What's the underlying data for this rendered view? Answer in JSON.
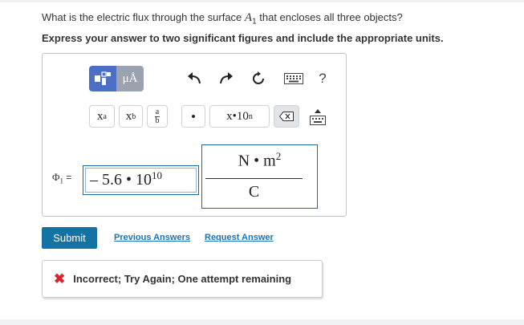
{
  "question": {
    "prefix": "What is the electric flux through the surface ",
    "symbol": "A",
    "subscript": "1",
    "suffix": " that encloses all three objects?",
    "instruction": "Express your answer to two significant figures and include the appropriate units."
  },
  "toolbar": {
    "templates_icon": "templates-icon",
    "units_label": "μÅ",
    "undo_icon": "undo-icon",
    "redo_icon": "redo-icon",
    "reset_icon": "reset-icon",
    "keyboard_icon": "keyboard-icon",
    "help_label": "?"
  },
  "toolbar2": {
    "superscript_base": "x",
    "superscript_exp": "a",
    "subscript_base": "x",
    "subscript_sub": "b",
    "frac_num": "a",
    "frac_den": "b",
    "dot_label": "•",
    "sci_label": "x•10",
    "sci_exp": "n"
  },
  "answer": {
    "label_symbol": "Φ",
    "label_sub": "1",
    "label_eq": "=",
    "value_mantissa": "– 5.6 • 10",
    "value_exponent": "10",
    "unit_numerator": "N • m",
    "unit_numerator_exp": "2",
    "unit_denominator": "C"
  },
  "actions": {
    "submit": "Submit",
    "previous_answers": "Previous Answers",
    "request_answer": "Request Answer"
  },
  "feedback": {
    "message": "Incorrect; Try Again; One attempt remaining",
    "color": "#d7262e"
  },
  "colors": {
    "accent": "#1473a5",
    "link": "#1a73b8",
    "template_button": "#4b6fc4"
  }
}
